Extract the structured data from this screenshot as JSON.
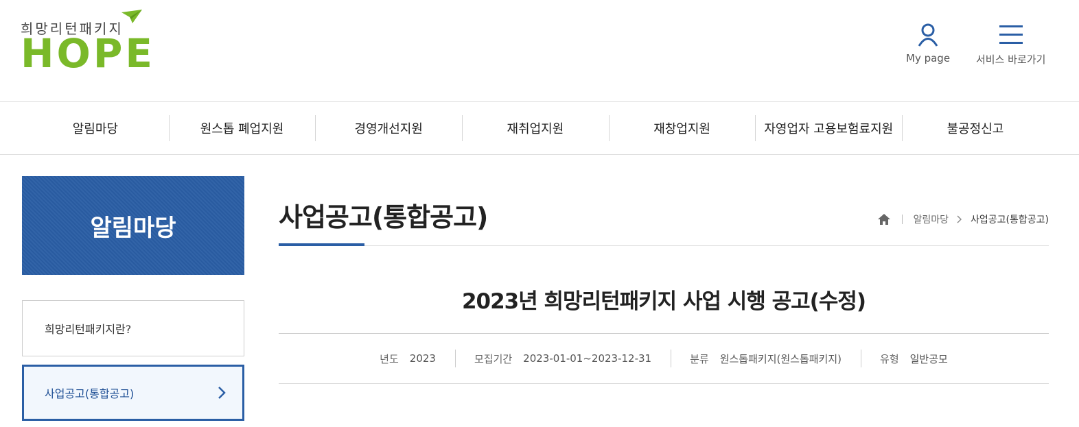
{
  "header": {
    "logo_sub": "희망리턴패키지",
    "logo_main": "HOPE",
    "mypage_label": "My page",
    "menu_label": "서비스 바로가기"
  },
  "gnb": {
    "items": [
      "알림마당",
      "원스톱 폐업지원",
      "경영개선지원",
      "재취업지원",
      "재창업지원",
      "자영업자 고용보험료지원",
      "불공정신고"
    ]
  },
  "lnb": {
    "title": "알림마당",
    "items": [
      "희망리턴패키지란?",
      "사업공고(통합공고)"
    ]
  },
  "content": {
    "page_title": "사업공고(통합공고)",
    "breadcrumb": [
      "알림마당",
      "사업공고(통합공고)"
    ],
    "post_title": "2023년 희망리턴패키지 사업 시행 공고(수정)",
    "info": [
      {
        "key": "년도",
        "value": "2023"
      },
      {
        "key": "모집기간",
        "value": "2023-01-01~2023-12-31"
      },
      {
        "key": "분류",
        "value": "원스톱패키지(원스톱패키지)"
      },
      {
        "key": "유형",
        "value": "일반공모"
      }
    ]
  },
  "colors": {
    "brand_green": "#7ab929",
    "primary_blue": "#2a5ea5"
  },
  "icons": [
    "paper-plane-icon",
    "user-icon",
    "hamburger-menu-icon",
    "home-icon",
    "chevron-right-icon"
  ]
}
